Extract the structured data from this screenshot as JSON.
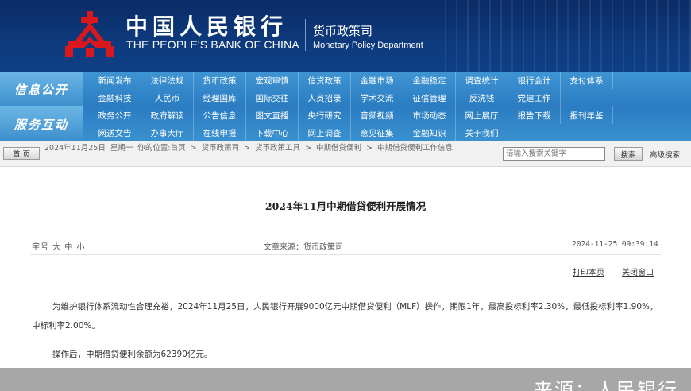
{
  "header": {
    "title_cn": "中国人民银行",
    "title_en": "THE PEOPLE'S BANK OF CHINA",
    "dept_cn": "货币政策司",
    "dept_en": "Monetary Policy Department",
    "logo_icon": "pboc-logo-icon",
    "brand_color": "#0d3a7d",
    "logo_color": "#d8181d"
  },
  "nav": {
    "label_1": "信息公开",
    "label_2": "服务互动",
    "rows": [
      [
        "新闻发布",
        "法律法规",
        "货币政策",
        "宏观审慎",
        "信贷政策",
        "金融市场",
        "金融稳定",
        "调查统计",
        "银行会计",
        "支付体系"
      ],
      [
        "金融科技",
        "人民币",
        "经理国库",
        "国际交往",
        "人员招录",
        "学术交流",
        "征信管理",
        "反洗钱",
        "党建工作"
      ],
      [
        "政务公开",
        "政府解读",
        "公告信息",
        "图文直播",
        "央行研究",
        "音频视频",
        "市场动态",
        "网上展厅",
        "报告下载",
        "报刊年鉴"
      ],
      [
        "网送文告",
        "办事大厅",
        "在线申报",
        "下载中心",
        "网上调查",
        "意见征集",
        "金融知识",
        "关于我们"
      ]
    ]
  },
  "breadcrumb": {
    "home_button": "首 页",
    "date": "2024年11月25日",
    "weekday": "星期一",
    "location_prefix": "你的位置:",
    "items": [
      "首页",
      "货币政策司",
      "货币政策工具",
      "中期借贷便利",
      "中期借贷便利工作信息"
    ],
    "separator": ">",
    "search_placeholder": "请输入搜索关键字",
    "search_button": "搜索",
    "advanced_search": "高级搜索"
  },
  "article": {
    "title": "2024年11月中期借贷便利开展情况",
    "font_size_label": "字号 大 中 小",
    "source_label": "文章来源：货币政策司",
    "datetime": "2024-11-25 09:39:14",
    "print_link": "打印本页",
    "close_link": "关闭窗口",
    "paragraph_1": "为维护银行体系流动性合理充裕，2024年11月25日，人民银行开展9000亿元中期借贷便利（MLF）操作，期限1年，最高投标利率2.30%，最低投标利率1.90%，中标利率2.00%。",
    "paragraph_2": "操作后，中期借贷便利余额为62390亿元。"
  },
  "overlay": {
    "source_text": "来源：人民银行"
  }
}
